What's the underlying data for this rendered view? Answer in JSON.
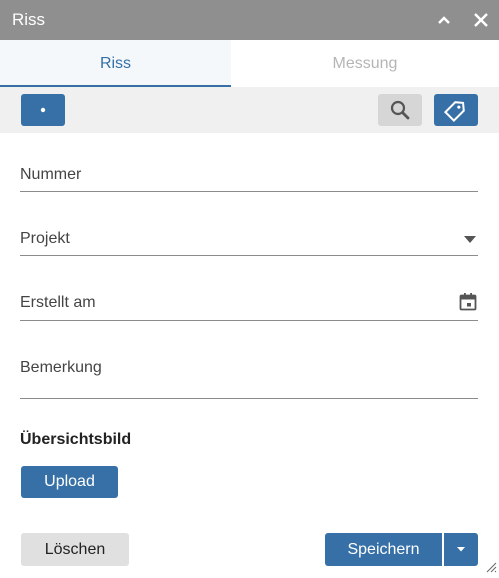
{
  "window": {
    "title": "Riss"
  },
  "tabs": [
    {
      "label": "Riss",
      "active": true
    },
    {
      "label": "Messung",
      "active": false
    }
  ],
  "form": {
    "nummer_label": "Nummer",
    "projekt_label": "Projekt",
    "erstellt_label": "Erstellt am",
    "bemerkung_label": "Bemerkung"
  },
  "section": {
    "title": "Übersichtsbild"
  },
  "buttons": {
    "upload": "Upload",
    "delete": "Löschen",
    "save": "Speichern"
  },
  "colors": {
    "accent": "#3670a6",
    "titlebar": "#8f8f8f",
    "toolbar": "#f0f0f0"
  },
  "icons": [
    "dot-icon",
    "search-icon",
    "tag-icon",
    "calendar-icon",
    "dropdown-arrow-icon",
    "chevron-up-icon",
    "close-icon"
  ]
}
